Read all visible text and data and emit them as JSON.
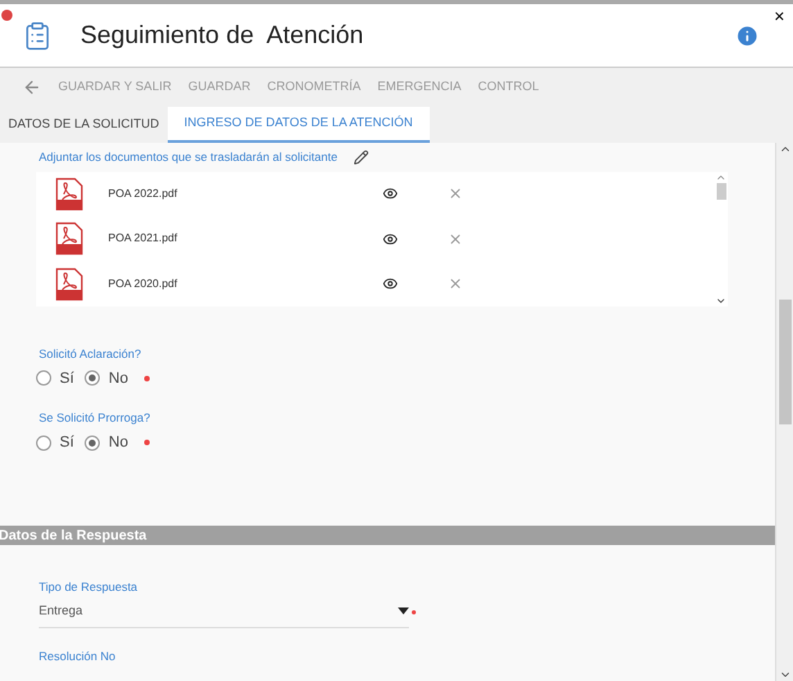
{
  "window": {
    "title": "Seguimiento de  Atención",
    "close": "×"
  },
  "toolbar": [
    "GUARDAR Y SALIR",
    "GUARDAR",
    "CRONOMETRÍA",
    "EMERGENCIA",
    "CONTROL"
  ],
  "tabs": [
    {
      "label": "DATOS DE LA SOLICITUD",
      "selected": false
    },
    {
      "label": "INGRESO DE DATOS DE LA ATENCIÓN",
      "selected": true
    }
  ],
  "attachments": {
    "label": "Adjuntar los documentos que se trasladarán al solicitante",
    "files": [
      {
        "name": "POA 2022.pdf"
      },
      {
        "name": "POA 2021.pdf"
      },
      {
        "name": "POA 2020.pdf"
      }
    ]
  },
  "questions": [
    {
      "label": "Solicitó Aclaración?",
      "options": [
        {
          "label": "Sí",
          "selected": false
        },
        {
          "label": "No",
          "selected": true
        }
      ]
    },
    {
      "label": "Se Solicitó Prorroga?",
      "options": [
        {
          "label": "Sí",
          "selected": false
        },
        {
          "label": "No",
          "selected": true
        }
      ]
    }
  ],
  "section": {
    "title": "Datos de la Respuesta"
  },
  "response_type": {
    "label": "Tipo de Respuesta",
    "value": "Entrega"
  },
  "next_field": {
    "label": "Resolución No"
  }
}
